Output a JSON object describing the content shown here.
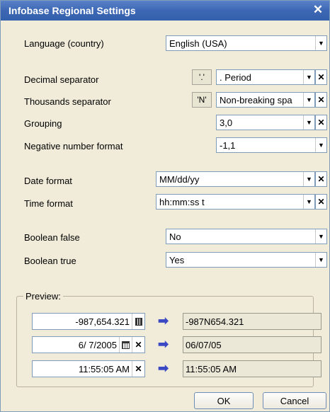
{
  "window": {
    "title": "Infobase Regional Settings"
  },
  "fields": {
    "language": {
      "label": "Language (country)",
      "value": "English (USA)"
    },
    "decimal_separator": {
      "label": "Decimal separator",
      "symbol": "'.'",
      "value": ". Period"
    },
    "thousands_separator": {
      "label": "Thousands separator",
      "symbol": "'N'",
      "value": "Non-breaking spa"
    },
    "grouping": {
      "label": "Grouping",
      "value": "3,0"
    },
    "negative_format": {
      "label": "Negative number format",
      "value": "-1,1"
    },
    "date_format": {
      "label": "Date format",
      "value": "MM/dd/yy"
    },
    "time_format": {
      "label": "Time format",
      "value": "hh:mm:ss t"
    },
    "boolean_false": {
      "label": "Boolean false",
      "value": "No"
    },
    "boolean_true": {
      "label": "Boolean true",
      "value": "Yes"
    }
  },
  "preview": {
    "legend": "Preview:",
    "rows": [
      {
        "input": "-987,654.321",
        "output": "-987N654.321"
      },
      {
        "input": "6/ 7/2005",
        "output": "06/07/05"
      },
      {
        "input": "11:55:05 AM",
        "output": "11:55:05 AM"
      }
    ]
  },
  "buttons": {
    "ok": "OK",
    "cancel": "Cancel"
  },
  "glyphs": {
    "close": "✕",
    "drop": "▼",
    "clear": "✕",
    "arrow": "➡"
  },
  "colors": {
    "titlebar": "#3d67b4",
    "window_bg": "#f1ecd9",
    "arrow": "#3b49c4"
  }
}
